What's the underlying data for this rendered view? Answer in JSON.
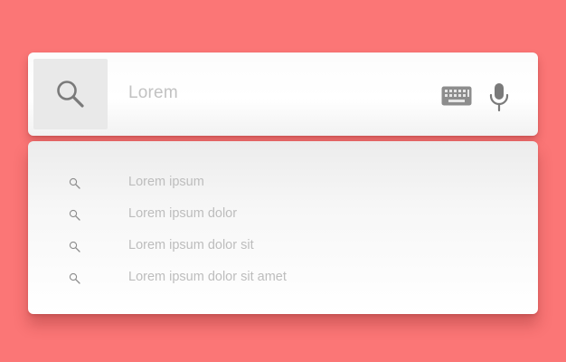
{
  "search": {
    "query": "Lorem",
    "icons": {
      "search": "search-icon",
      "keyboard": "keyboard-icon",
      "mic": "microphone-icon"
    }
  },
  "suggestions": [
    {
      "label": "Lorem ipsum",
      "icon": "search-icon"
    },
    {
      "label": "Lorem ipsum dolor",
      "icon": "search-icon"
    },
    {
      "label": "Lorem ipsum dolor sit",
      "icon": "search-icon"
    },
    {
      "label": "Lorem ipsum dolor sit amet",
      "icon": "search-icon"
    }
  ],
  "colors": {
    "background": "#fb7676",
    "icon": "#7a7a7a",
    "text": "#bdbdbd"
  }
}
